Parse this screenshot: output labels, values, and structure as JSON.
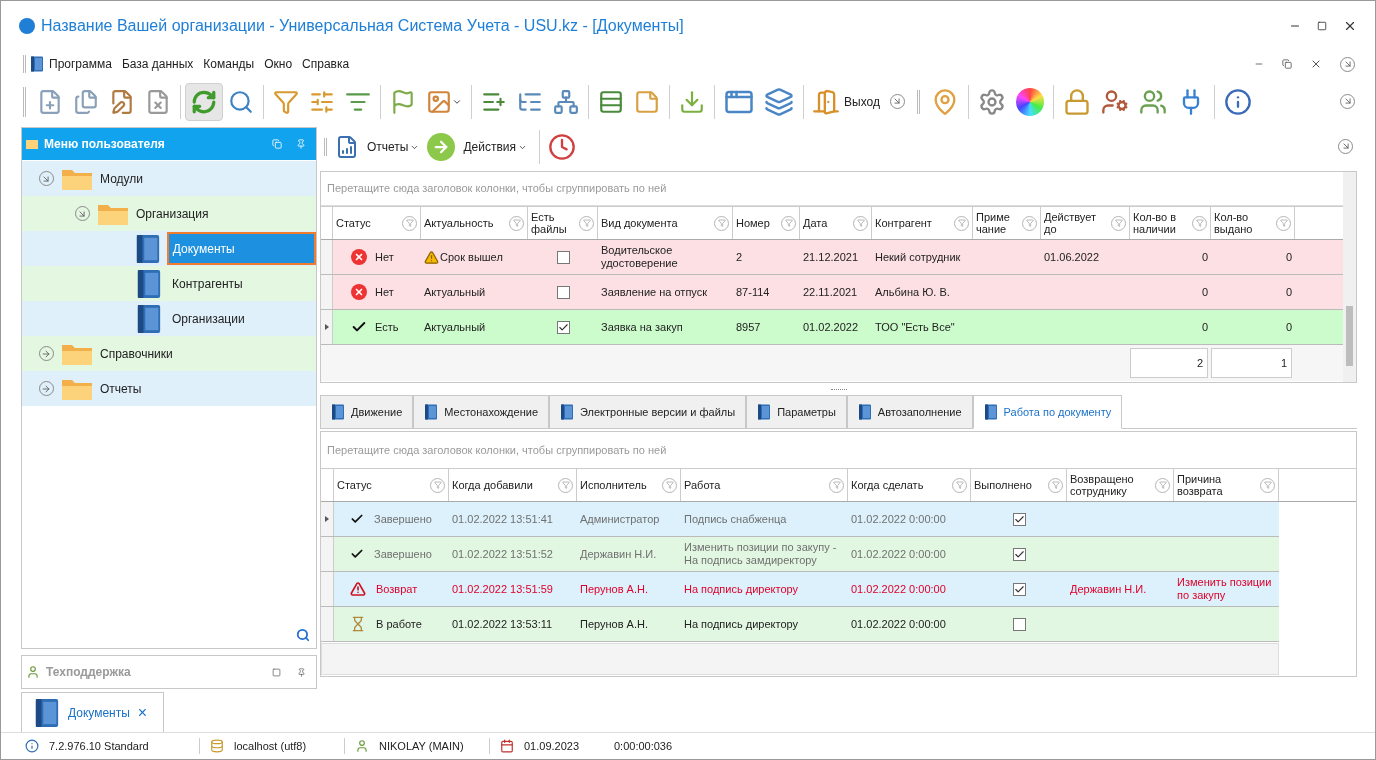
{
  "window": {
    "title": "Название Вашей организации - Универсальная Система Учета - USU.kz - [Документы]"
  },
  "menu": [
    "Программа",
    "База данных",
    "Команды",
    "Окно",
    "Справка"
  ],
  "toolbar": {
    "exit_label": "Выход"
  },
  "user_menu": {
    "title": "Меню пользователя",
    "tree": [
      {
        "label": "Модули",
        "kind": "folder",
        "expanded": true,
        "selected": false,
        "children": [
          {
            "label": "Организация",
            "kind": "folder",
            "expanded": true,
            "selected": false,
            "children": [
              {
                "label": "Документы",
                "kind": "book",
                "selected": true
              },
              {
                "label": "Контрагенты",
                "kind": "book",
                "selected": false
              },
              {
                "label": "Организации",
                "kind": "book",
                "selected": false
              }
            ]
          }
        ]
      },
      {
        "label": "Справочники",
        "kind": "folder",
        "expanded": false,
        "selected": false
      },
      {
        "label": "Отчеты",
        "kind": "folder",
        "expanded": false,
        "selected": false
      }
    ]
  },
  "support_panel": {
    "title": "Техподдержка"
  },
  "subtoolbar": {
    "reports": "Отчеты",
    "actions": "Действия"
  },
  "documents": {
    "group_hint": "Перетащите сюда заголовок колонки, чтобы сгруппировать по ней",
    "columns": [
      "Статус",
      "Актуальность",
      "Есть\nфайлы",
      "Вид документа",
      "Номер",
      "Дата",
      "Контрагент",
      "Приме\nчание",
      "Действует\nдо",
      "Кол-во в\nналичии",
      "Кол-во\nвыдано"
    ],
    "rows": [
      {
        "status": {
          "kind": "error",
          "text": "Нет"
        },
        "actuality": {
          "kind": "warning",
          "text": "Срок вышел"
        },
        "has_files": false,
        "doc_type": "Водительское удостоверение",
        "number": "2",
        "date": "21.12.2021",
        "contractor": "Некий сотрудник",
        "valid_until": "01.06.2022",
        "in_stock": "0",
        "issued": "0",
        "current": false
      },
      {
        "status": {
          "kind": "error",
          "text": "Нет"
        },
        "actuality": {
          "kind": "normal",
          "text": "Актуальный"
        },
        "has_files": false,
        "doc_type": "Заявление на отпуск",
        "number": "87-114",
        "date": "22.11.2021",
        "contractor": "Альбина Ю. В.",
        "in_stock": "0",
        "issued": "0",
        "current": false
      },
      {
        "status": {
          "kind": "ok",
          "text": "Есть"
        },
        "actuality": {
          "kind": "normal",
          "text": "Актуальный"
        },
        "has_files": true,
        "doc_type": "Заявка на закуп",
        "number": "8957",
        "date": "01.02.2022",
        "contractor": "ТОО \"Есть Все\"",
        "in_stock": "0",
        "issued": "0",
        "current": true
      }
    ],
    "totals": {
      "in_stock": "2",
      "issued": "1"
    }
  },
  "tabs": [
    {
      "label": "Движение",
      "selected": false
    },
    {
      "label": "Местонахождение",
      "selected": false
    },
    {
      "label": "Электронные версии и файлы",
      "selected": false
    },
    {
      "label": "Параметры",
      "selected": false
    },
    {
      "label": "Автозаполнение",
      "selected": false
    },
    {
      "label": "Работа по документу",
      "selected": true
    }
  ],
  "work": {
    "group_hint": "Перетащите сюда заголовок колонки, чтобы сгруппировать по ней",
    "columns": [
      "Статус",
      "Когда добавили",
      "Исполнитель",
      "Работа",
      "Когда сделать",
      "Выполнено",
      "Возвращено\nсотруднику",
      "Причина\nвозврата"
    ],
    "rows": [
      {
        "kind": "done",
        "status": "Завершено",
        "added": "01.02.2022 13:51:41",
        "executor": "Администратор",
        "work": "Подпись снабженца",
        "due": "01.02.2022 0:00:00",
        "done": true,
        "current": true
      },
      {
        "kind": "done",
        "status": "Завершено",
        "added": "01.02.2022 13:51:52",
        "executor": "Державин Н.И.",
        "work": "Изменить позиции по закупу - На подпись замдиректору",
        "due": "01.02.2022 0:00:00",
        "done": true,
        "current": false
      },
      {
        "kind": "returned",
        "status": "Возврат",
        "added": "01.02.2022 13:51:59",
        "executor": "Перунов А.Н.",
        "work": "На подпись директору",
        "due": "01.02.2022 0:00:00",
        "done": true,
        "returned_to": "Державин Н.И.",
        "reason": "Изменить позиции по закупу",
        "current": false
      },
      {
        "kind": "in_work",
        "status": "В работе",
        "added": "01.02.2022 13:53:11",
        "executor": "Перунов А.Н.",
        "work": "На подпись директору",
        "due": "01.02.2022 0:00:00",
        "done": false,
        "current": false
      }
    ]
  },
  "open_tab": {
    "label": "Документы",
    "close": "×"
  },
  "status_bar": {
    "version": "7.2.976.10 Standard",
    "server": "localhost (utf8)",
    "user": "NIKOLAY (MAIN)",
    "date": "01.09.2023",
    "timer": "0:00:00:036"
  }
}
